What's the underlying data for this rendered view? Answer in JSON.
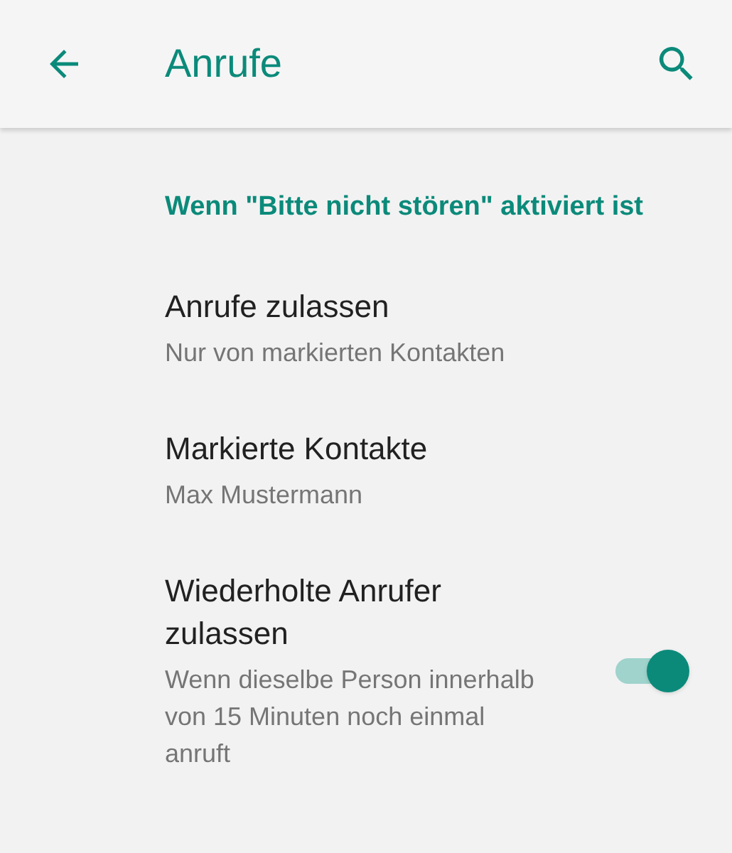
{
  "app_bar": {
    "title": "Anrufe"
  },
  "section": {
    "header": "Wenn \"Bitte nicht stören\" aktiviert ist"
  },
  "items": [
    {
      "kind": "link",
      "title": "Anrufe zulassen",
      "subtitle": "Nur von markierten Kontakten"
    },
    {
      "kind": "link",
      "title": "Markierte Kontakte",
      "subtitle": "Max Mustermann"
    },
    {
      "kind": "switch",
      "title": "Wiederholte Anrufer zulassen",
      "subtitle": "Wenn dieselbe Person innerhalb von 15 Minuten noch einmal anruft",
      "on": true
    }
  ]
}
